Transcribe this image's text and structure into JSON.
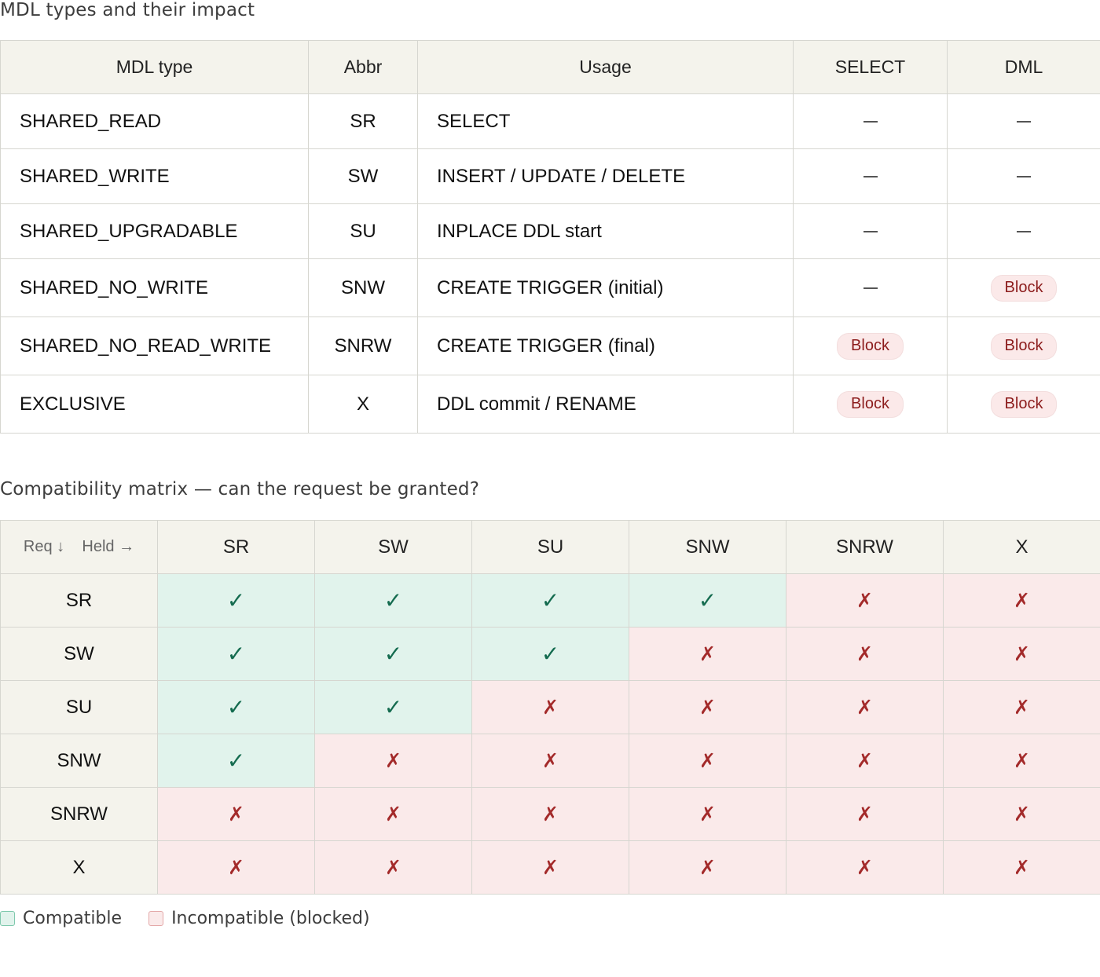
{
  "title1": "MDL types and their impact",
  "mdl_table": {
    "headers": [
      "MDL type",
      "Abbr",
      "Usage",
      "SELECT",
      "DML"
    ],
    "rows": [
      {
        "type": "SHARED_READ",
        "abbr": "SR",
        "usage": "SELECT",
        "select": "—",
        "dml": "—"
      },
      {
        "type": "SHARED_WRITE",
        "abbr": "SW",
        "usage": "INSERT / UPDATE / DELETE",
        "select": "—",
        "dml": "—"
      },
      {
        "type": "SHARED_UPGRADABLE",
        "abbr": "SU",
        "usage": "INPLACE DDL start",
        "select": "—",
        "dml": "—"
      },
      {
        "type": "SHARED_NO_WRITE",
        "abbr": "SNW",
        "usage": "CREATE TRIGGER (initial)",
        "select": "—",
        "dml": "Block"
      },
      {
        "type": "SHARED_NO_READ_WRITE",
        "abbr": "SNRW",
        "usage": "CREATE TRIGGER (final)",
        "select": "Block",
        "dml": "Block"
      },
      {
        "type": "EXCLUSIVE",
        "abbr": "X",
        "usage": "DDL commit / RENAME",
        "select": "Block",
        "dml": "Block"
      }
    ]
  },
  "title2": "Compatibility matrix — can the request be granted?",
  "matrix": {
    "corner_req": "Req ↓",
    "corner_held": "Held →",
    "columns": [
      "SR",
      "SW",
      "SU",
      "SNW",
      "SNRW",
      "X"
    ],
    "rows": [
      {
        "label": "SR",
        "cells": [
          true,
          true,
          true,
          true,
          false,
          false
        ]
      },
      {
        "label": "SW",
        "cells": [
          true,
          true,
          true,
          false,
          false,
          false
        ]
      },
      {
        "label": "SU",
        "cells": [
          true,
          true,
          false,
          false,
          false,
          false
        ]
      },
      {
        "label": "SNW",
        "cells": [
          true,
          false,
          false,
          false,
          false,
          false
        ]
      },
      {
        "label": "SNRW",
        "cells": [
          false,
          false,
          false,
          false,
          false,
          false
        ]
      },
      {
        "label": "X",
        "cells": [
          false,
          false,
          false,
          false,
          false,
          false
        ]
      }
    ],
    "symbol_ok": "✓",
    "symbol_no": "✗"
  },
  "legend": {
    "compatible": "Compatible",
    "incompatible": "Incompatible (blocked)"
  },
  "colors": {
    "compatible_bg": "#e1f3ec",
    "incompatible_bg": "#faeaea",
    "header_bg": "#f4f3ec",
    "block_text": "#8c1c1c"
  }
}
